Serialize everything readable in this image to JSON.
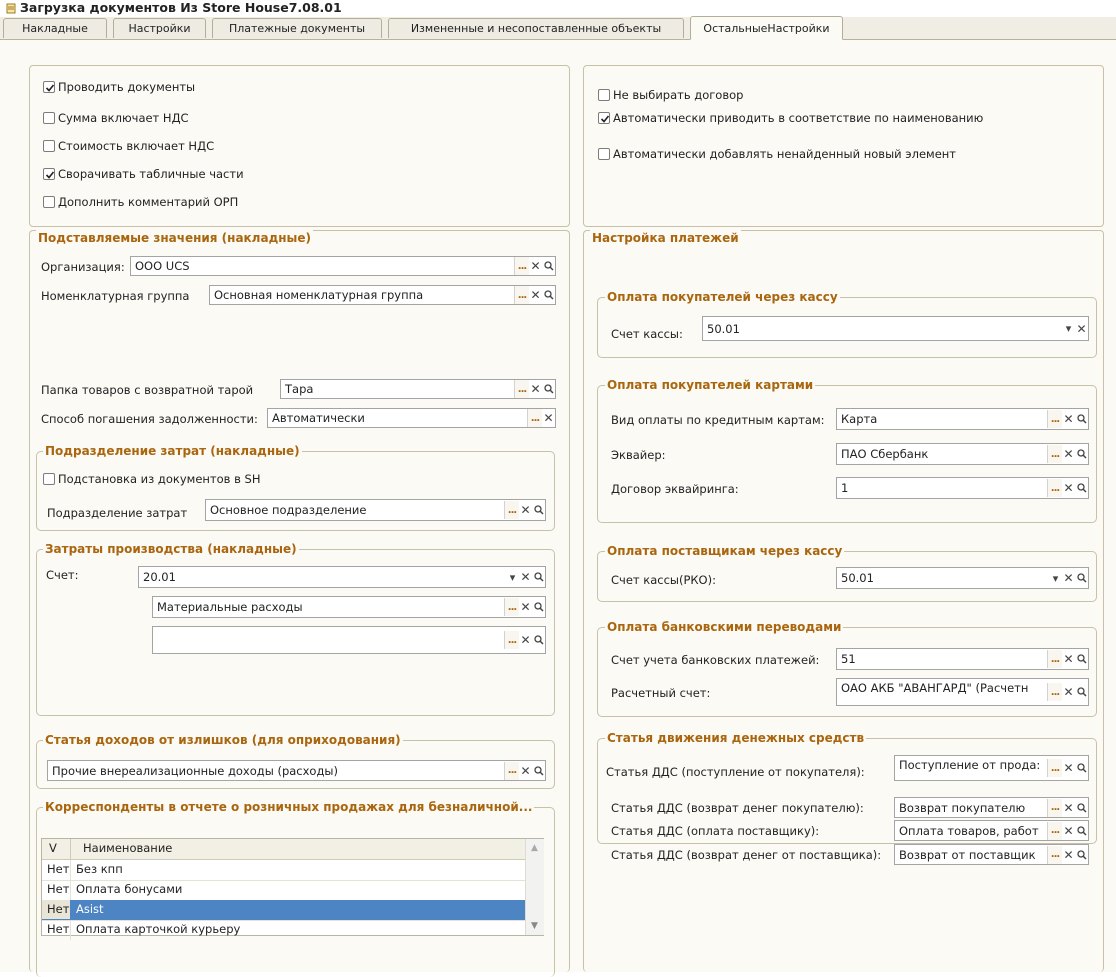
{
  "window": {
    "title": "Загрузка документов Из Store House7.08.01"
  },
  "tabs": [
    {
      "label": "Накладные"
    },
    {
      "label": "Настройки"
    },
    {
      "label": "Платежные документы"
    },
    {
      "label": "Измененные и несопоставленные объекты"
    },
    {
      "label": "ОстальныеНастройки"
    }
  ],
  "top_left": {
    "items": [
      {
        "label": "Проводить документы",
        "checked": true
      },
      {
        "label": "Сумма включает НДС",
        "checked": false
      },
      {
        "label": "Стоимость включает НДС",
        "checked": false
      },
      {
        "label": "Сворачивать табличные части",
        "checked": true
      },
      {
        "label": "Дополнить комментарий ОРП",
        "checked": false
      }
    ]
  },
  "top_right": {
    "items": [
      {
        "label": "Не выбирать договор",
        "checked": false
      },
      {
        "label": "Автоматически приводить в соответствие по наименованию",
        "checked": true
      },
      {
        "label": "Автоматически добавлять ненайденный новый элемент",
        "checked": false
      }
    ]
  },
  "subst": {
    "title": "Подставляемые значения (накладные)",
    "org_label": "Организация:",
    "org_value": "ООО UCS",
    "nomgroup_label": "Номенклатурная группа",
    "nomgroup_value": "Основная номенклатурная группа",
    "folder_label": "Папка товаров с возвратной тарой",
    "folder_value": "Тара",
    "debt_label": "Способ погашения задолженности:",
    "debt_value": "Автоматически"
  },
  "costdiv": {
    "title": "Подразделение затрат (накладные)",
    "check_label": "Подстановка из документов в SH",
    "check_checked": false,
    "div_label": "Подразделение затрат",
    "div_value": "Основное подразделение"
  },
  "prodcost": {
    "title": "Затраты производства (накладные)",
    "account_label": "Счет:",
    "account_value": "20.01",
    "sub1_value": "Материальные расходы",
    "sub2_value": ""
  },
  "surplus": {
    "title": "Статья доходов от излишков (для оприходования)",
    "value": "Прочие внереализационные доходы (расходы)"
  },
  "corr": {
    "title": "Корреспонденты в отчете о розничных продажах  для безналичной...",
    "col_v": "V",
    "col_name": "Наименование",
    "rows": [
      {
        "v": "Нет",
        "name": "Без кпп"
      },
      {
        "v": "Нет",
        "name": "Оплата бонусами"
      },
      {
        "v": "Нет",
        "name": "Asist"
      },
      {
        "v": "Нет",
        "name": "Оплата карточкой курьеру"
      }
    ],
    "selected_row": 2
  },
  "payments": {
    "title": "Настройка платежей",
    "cash_in": {
      "title": "Оплата покупателей через кассу",
      "label": "Счет кассы:",
      "value": "50.01"
    },
    "cards": {
      "title": "Оплата покупателей картами",
      "type_label": "Вид оплаты по кредитным картам:",
      "type_value": "Карта",
      "acquirer_label": "Эквайер:",
      "acquirer_value": "ПАО Сбербанк",
      "contract_label": "Договор эквайринга:",
      "contract_value": "1"
    },
    "cash_out": {
      "title": "Оплата поставщикам через кассу",
      "label": "Счет кассы(РКО):",
      "value": "50.01"
    },
    "bank": {
      "title": "Оплата банковскими переводами",
      "account_label": "Счет учета банковских платежей:",
      "account_value": "51",
      "settle_label": "Расчетный счет:",
      "settle_value": "ОАО АКБ \"АВАНГАРД\" (Расчетн"
    },
    "dds": {
      "title": "Статья движения денежных средств",
      "rows": [
        {
          "label": "Статья ДДС (поступление от покупателя):",
          "value": "Поступление от прода:"
        },
        {
          "label": "Статья ДДС (возврат денег покупателю):",
          "value": "Возврат покупателю"
        },
        {
          "label": "Статья ДДС (оплата поставщику):",
          "value": "Оплата товаров, работ"
        },
        {
          "label": "Статья ДДС (возврат денег от поставщика):",
          "value": "Возврат от поставщик"
        }
      ]
    }
  }
}
